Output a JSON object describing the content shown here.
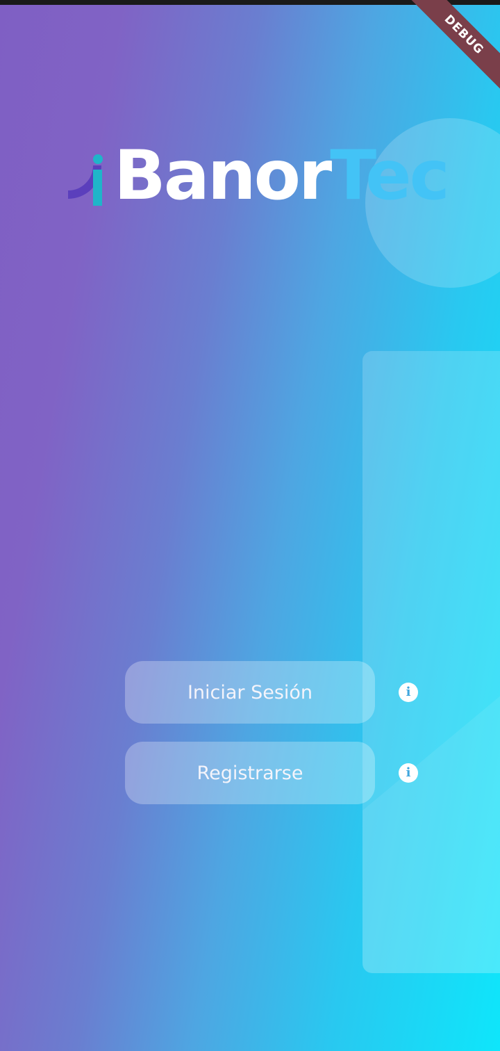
{
  "app": {
    "logo_text_primary": "Banor",
    "logo_text_secondary": "Tec"
  },
  "buttons": {
    "login_label": "Iniciar Sesión",
    "register_label": "Registrarse"
  },
  "icons": {
    "login_info": "info-icon",
    "register_info": "info-icon"
  },
  "debug_banner": "DEBUG",
  "colors": {
    "gradient_start": "#7f5fc4",
    "gradient_end": "#0ee6fb",
    "logo_primary": "#ffffff",
    "logo_secondary": "#43c3f6",
    "logo_mark_purple": "#5b3fbc",
    "logo_mark_teal": "#1fb5c9",
    "debug_ribbon": "#7a3f4a"
  }
}
